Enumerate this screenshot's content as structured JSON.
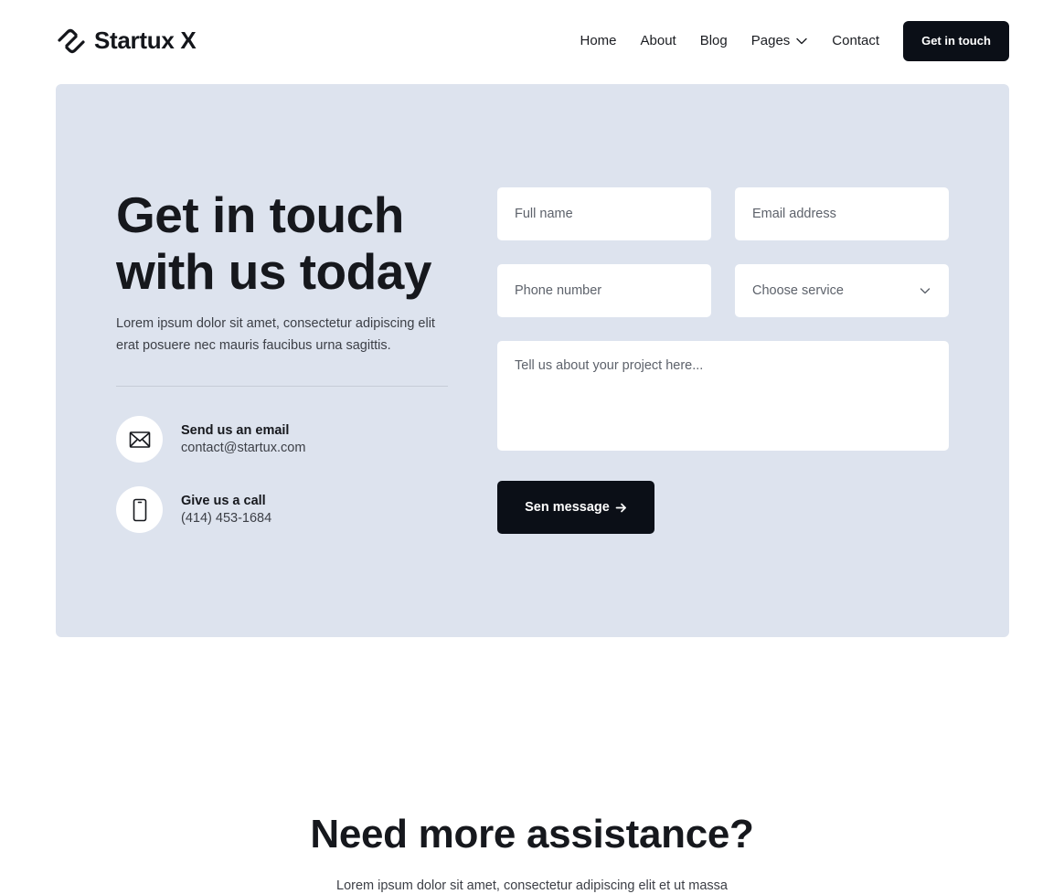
{
  "brand": {
    "name": "Startux X",
    "logo_icon": "link-arrow-logo-icon"
  },
  "nav": {
    "items": [
      {
        "label": "Home"
      },
      {
        "label": "About"
      },
      {
        "label": "Blog"
      },
      {
        "label": "Pages",
        "icon": "chevron-down-icon"
      },
      {
        "label": "Contact"
      }
    ],
    "cta_label": "Get in touch"
  },
  "hero": {
    "title": "Get in touch with us today",
    "description": "Lorem ipsum dolor sit amet, consectetur adipiscing elit erat posuere nec mauris faucibus urna sagittis."
  },
  "contacts": [
    {
      "label": "Send us an email",
      "value": "contact@startux.com",
      "icon": "envelope-icon"
    },
    {
      "label": "Give us a call",
      "value": "(414) 453-1684",
      "icon": "phone-icon"
    }
  ],
  "form": {
    "full_name": {
      "placeholder": "Full name",
      "value": ""
    },
    "email": {
      "placeholder": "Email address",
      "value": ""
    },
    "phone": {
      "placeholder": "Phone number",
      "value": ""
    },
    "service": {
      "selected": "Choose service"
    },
    "message": {
      "placeholder": "Tell us about your project here...",
      "value": ""
    },
    "submit_label": "Sen message",
    "submit_icon": "arrow-right-icon"
  },
  "assistance": {
    "title": "Need more assistance?",
    "description": "Lorem ipsum dolor sit amet, consectetur adipiscing elit et ut massa"
  },
  "colors": {
    "panel_background": "#dde3ee",
    "button_dark": "#0b0f17",
    "text_primary": "#16181d",
    "text_secondary": "#3c3f46"
  }
}
